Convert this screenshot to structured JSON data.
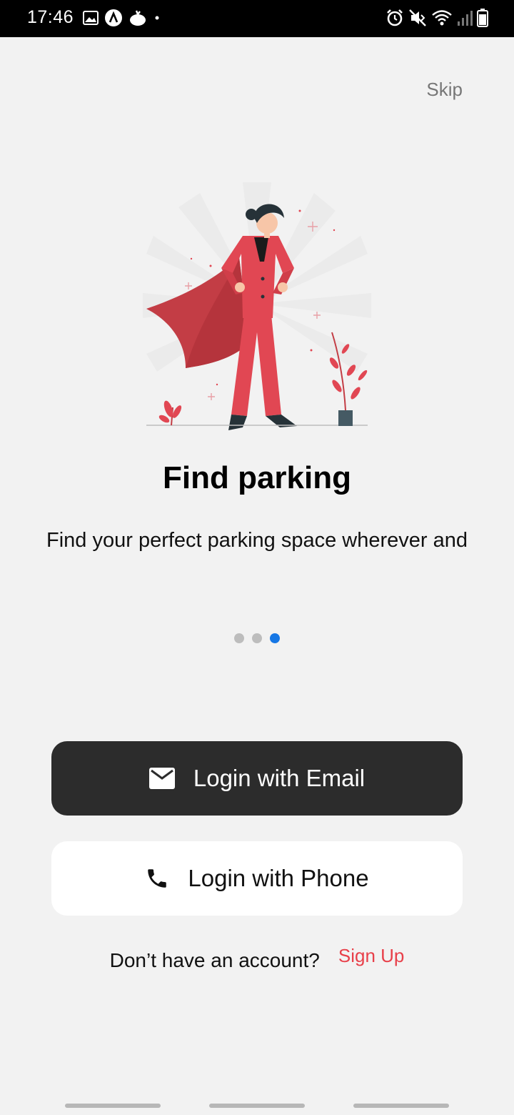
{
  "status_bar": {
    "time": "17:46",
    "left_icons": [
      "image-icon",
      "app-a-icon",
      "tomato-icon",
      "dot-icon"
    ],
    "right_icons": [
      "alarm-icon",
      "mute-icon",
      "wifi-icon",
      "signal-icon",
      "battery-icon"
    ]
  },
  "onboarding": {
    "skip_label": "Skip",
    "title": "Find parking",
    "description": "Find your perfect parking space wherever and",
    "page_count": 3,
    "active_page": 3,
    "illustration": "superhero-woman-illustration"
  },
  "auth": {
    "email_button_label": "Login with Email",
    "email_icon": "mail-icon",
    "phone_button_label": "Login with Phone",
    "phone_icon": "phone-icon",
    "signup_question": "Don’t have an account?",
    "signup_link": "Sign Up"
  },
  "colors": {
    "accent_red": "#e8404a",
    "active_dot": "#1677e5",
    "email_button_bg": "#2c2c2c",
    "background": "#f2f2f2"
  }
}
